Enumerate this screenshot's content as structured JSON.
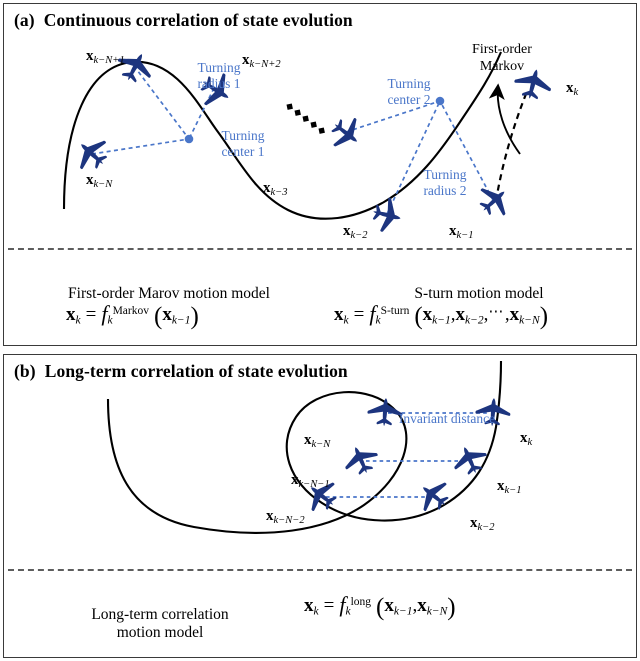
{
  "figure": {
    "background": "#ffffff",
    "aircraft_color": "#1d357f",
    "accent_blue": "#4a76c9",
    "line_color": "#000000"
  },
  "panel_a": {
    "tag": "(a)",
    "title": "Continuous correlation of state evolution",
    "state_labels": {
      "k_minus_N_plus_1": {
        "base": "x",
        "sub": "k−N+1"
      },
      "k_minus_N_plus_2": {
        "base": "x",
        "sub": "k−N+2"
      },
      "k_minus_N": {
        "base": "x",
        "sub": "k−N"
      },
      "k_minus_3": {
        "base": "x",
        "sub": "k−3"
      },
      "k_minus_2": {
        "base": "x",
        "sub": "k−2"
      },
      "k_minus_1": {
        "base": "x",
        "sub": "k−1"
      },
      "k": {
        "base": "x",
        "sub": "k"
      }
    },
    "annotations": {
      "turning_radius_1": "Turning\nradius 1",
      "turning_center_1": "Turning\ncenter 1",
      "turning_center_2": "Turning\ncenter 2",
      "turning_radius_2": "Turning\nradius 2",
      "first_order_markov": "First-order\nMarkov",
      "ellipsis": "▪ ▪ ▪ ▪"
    },
    "models": [
      {
        "name": "First-order Marov motion model",
        "formula": {
          "lhs_base": "x",
          "lhs_sub": "k",
          "fn": "f",
          "fn_sub": "k",
          "fn_sup": "Markov",
          "args": [
            "x k−1"
          ]
        }
      },
      {
        "name": "S-turn motion model",
        "formula": {
          "lhs_base": "x",
          "lhs_sub": "k",
          "fn": "f",
          "fn_sub": "k",
          "fn_sup": "S-turn",
          "args": [
            "x k−1",
            "x k−2",
            "⋯",
            "x k−N"
          ]
        }
      }
    ]
  },
  "panel_b": {
    "tag": "(b)",
    "title": "Long-term correlation of state evolution",
    "state_labels": {
      "k_minus_N": {
        "base": "x",
        "sub": "k−N"
      },
      "k_minus_N_1": {
        "base": "x",
        "sub": "k−N−1"
      },
      "k_minus_N_2": {
        "base": "x",
        "sub": "k−N−2"
      },
      "k": {
        "base": "x",
        "sub": "k"
      },
      "k_minus_1": {
        "base": "x",
        "sub": "k−1"
      },
      "k_minus_2": {
        "base": "x",
        "sub": "k−2"
      }
    },
    "annotations": {
      "invariant_distance": "Invariant distance"
    },
    "model": {
      "name": "Long-term correlation\nmotion model",
      "formula": {
        "lhs_base": "x",
        "lhs_sub": "k",
        "fn": "f",
        "fn_sub": "k",
        "fn_sup": "long",
        "args": [
          "x k−1",
          "x k−N"
        ]
      }
    }
  }
}
